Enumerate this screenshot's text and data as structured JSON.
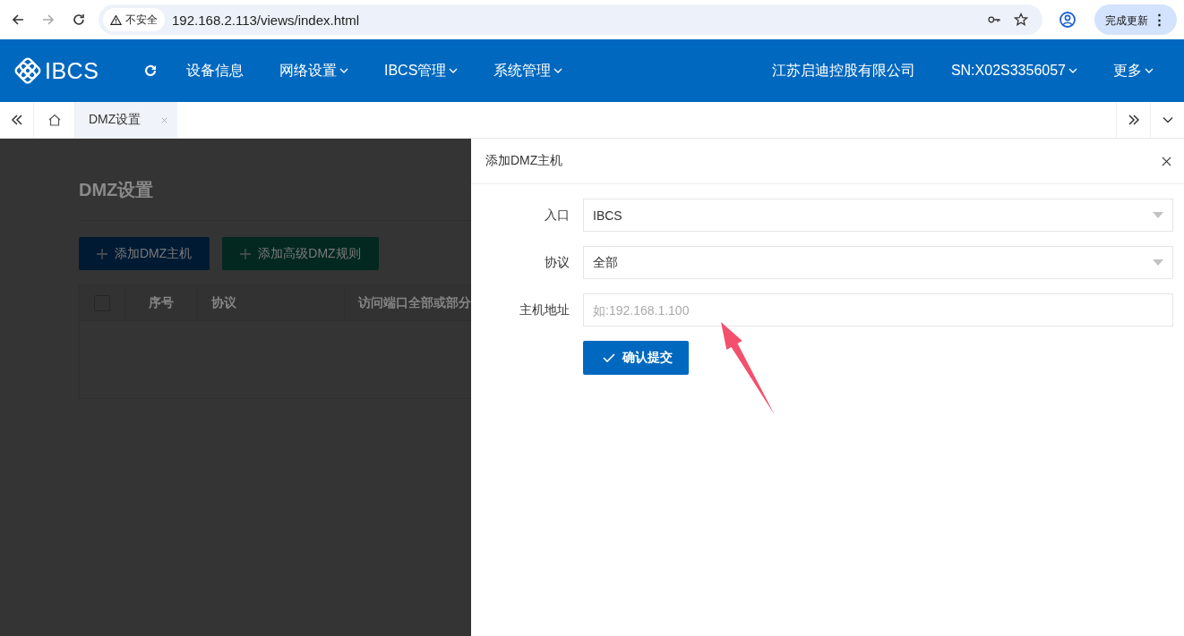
{
  "browser": {
    "security_label": "不安全",
    "url": "192.168.2.113/views/index.html",
    "update_button": "完成更新",
    "menu_glyph": "⋮"
  },
  "header": {
    "logo": "IBCS",
    "nav": [
      {
        "label": "设备信息",
        "dropdown": false
      },
      {
        "label": "网络设置",
        "dropdown": true
      },
      {
        "label": "IBCS管理",
        "dropdown": true
      },
      {
        "label": "系统管理",
        "dropdown": true
      }
    ],
    "right": [
      {
        "label": "江苏启迪控股有限公司",
        "dropdown": false
      },
      {
        "label": "SN:X02S3356057",
        "dropdown": true
      },
      {
        "label": "更多",
        "dropdown": true
      }
    ]
  },
  "tabs": [
    {
      "label": "DMZ设置",
      "selected": true,
      "closable": true
    }
  ],
  "page": {
    "title": "DMZ设置",
    "buttons": [
      {
        "label": "添加DMZ主机",
        "kind": "primary"
      },
      {
        "label": "添加高级DMZ规则",
        "kind": "success"
      }
    ],
    "table": {
      "select_all_checked": false,
      "columns": [
        "序号",
        "协议",
        "访问端口全部或部分"
      ]
    }
  },
  "drawer": {
    "title": "添加DMZ主机",
    "fields": [
      {
        "label": "入口",
        "kind": "select",
        "value": "IBCS"
      },
      {
        "label": "协议",
        "kind": "select",
        "value": "全部"
      },
      {
        "label": "主机地址",
        "kind": "input",
        "placeholder": "如:192.168.1.100"
      }
    ],
    "submit": "确认提交"
  }
}
